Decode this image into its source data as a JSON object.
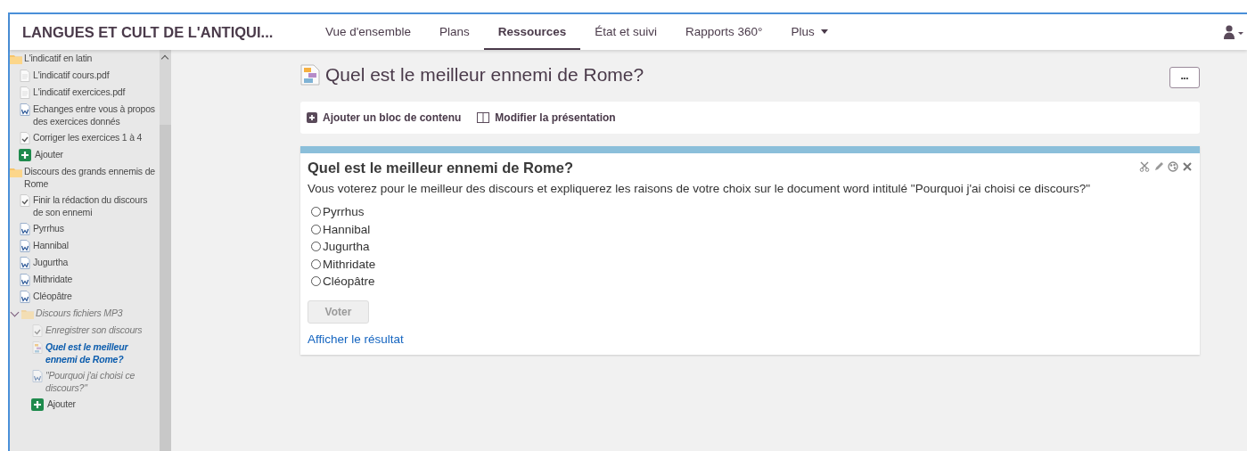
{
  "header": {
    "site_title": "LANGUES ET CULT DE L'ANTIQUI...",
    "tabs": [
      {
        "label": "Vue d'ensemble",
        "selected": false,
        "dropdown": false
      },
      {
        "label": "Plans",
        "selected": false,
        "dropdown": false
      },
      {
        "label": "Ressources",
        "selected": true,
        "dropdown": false
      },
      {
        "label": "État et suivi",
        "selected": false,
        "dropdown": false
      },
      {
        "label": "Rapports 360°",
        "selected": false,
        "dropdown": false
      },
      {
        "label": "Plus",
        "selected": false,
        "dropdown": true
      }
    ]
  },
  "sidebar": {
    "items": [
      {
        "kind": "folder",
        "label": "L'indicatif en latin",
        "hidden": false,
        "selected": false,
        "expanded": false,
        "children": [
          {
            "kind": "pdf",
            "label": "L'indicatif cours.pdf",
            "hidden": false,
            "selected": false
          },
          {
            "kind": "pdf",
            "label": "L'indicatif exercices.pdf",
            "hidden": false,
            "selected": false
          },
          {
            "kind": "word",
            "label": "Echanges entre vous à propos des exercices donnés",
            "hidden": false,
            "selected": false
          },
          {
            "kind": "task",
            "label": "Corriger les exercices 1 à 4",
            "hidden": false,
            "selected": false
          },
          {
            "kind": "add",
            "label": "Ajouter",
            "hidden": false,
            "selected": false
          }
        ]
      },
      {
        "kind": "folder",
        "label": "Discours des grands ennemis de Rome",
        "hidden": false,
        "selected": false,
        "expanded": false,
        "children": [
          {
            "kind": "task",
            "label": "Finir la rédaction du discours de son ennemi",
            "hidden": false,
            "selected": false
          },
          {
            "kind": "word",
            "label": "Pyrrhus",
            "hidden": false,
            "selected": false
          },
          {
            "kind": "word",
            "label": "Hannibal",
            "hidden": false,
            "selected": false
          },
          {
            "kind": "word",
            "label": "Jugurtha",
            "hidden": false,
            "selected": false
          },
          {
            "kind": "word",
            "label": "Mithridate",
            "hidden": false,
            "selected": false
          },
          {
            "kind": "word",
            "label": "Cléopâtre",
            "hidden": false,
            "selected": false
          },
          {
            "kind": "folder",
            "label": "Discours fichiers MP3",
            "hidden": true,
            "selected": false,
            "expanded": true,
            "children": [
              {
                "kind": "task",
                "label": "Enregistrer son discours",
                "hidden": true,
                "selected": false
              },
              {
                "kind": "page",
                "label": "Quel est le meilleur ennemi de Rome?",
                "hidden": true,
                "selected": true
              },
              {
                "kind": "word",
                "label": "\"Pourquoi j'ai choisi ce discours?\"",
                "hidden": true,
                "selected": false
              },
              {
                "kind": "add",
                "label": "Ajouter",
                "hidden": false,
                "selected": false
              }
            ]
          }
        ]
      }
    ]
  },
  "page": {
    "title": "Quel est le meilleur ennemi de Rome?",
    "more_button": "•••",
    "toolbar": [
      "Ajouter un bloc de contenu",
      "Modifier la présentation"
    ],
    "poll": {
      "title": "Quel est le meilleur ennemi de Rome?",
      "description": "Vous voterez pour le meilleur des discours et expliquerez les raisons de votre choix sur le document word intitulé \"Pourquoi j'ai choisi ce discours?\"",
      "options": [
        {
          "label": "Pyrrhus",
          "selected": false
        },
        {
          "label": "Hannibal",
          "selected": false
        },
        {
          "label": "Jugurtha",
          "selected": false
        },
        {
          "label": "Mithridate",
          "selected": false
        },
        {
          "label": "Cléopâtre",
          "selected": false
        }
      ],
      "vote_button": {
        "label": "Voter",
        "disabled": true
      },
      "result_link": "Afficher le résultat"
    }
  }
}
